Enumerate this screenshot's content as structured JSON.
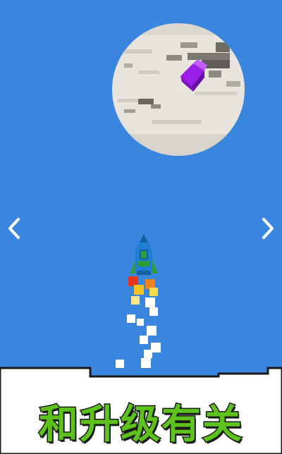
{
  "scene": {
    "sky_color": "#3a86df",
    "ground_color": "#ffffff",
    "moon_color": "#e6e3dc",
    "gem_color": "#8a14d6"
  },
  "navigation": {
    "prev_icon": "chevron-left-icon",
    "next_icon": "chevron-right-icon"
  },
  "caption": {
    "text": "和升级有关",
    "color": "#5ec21c"
  }
}
